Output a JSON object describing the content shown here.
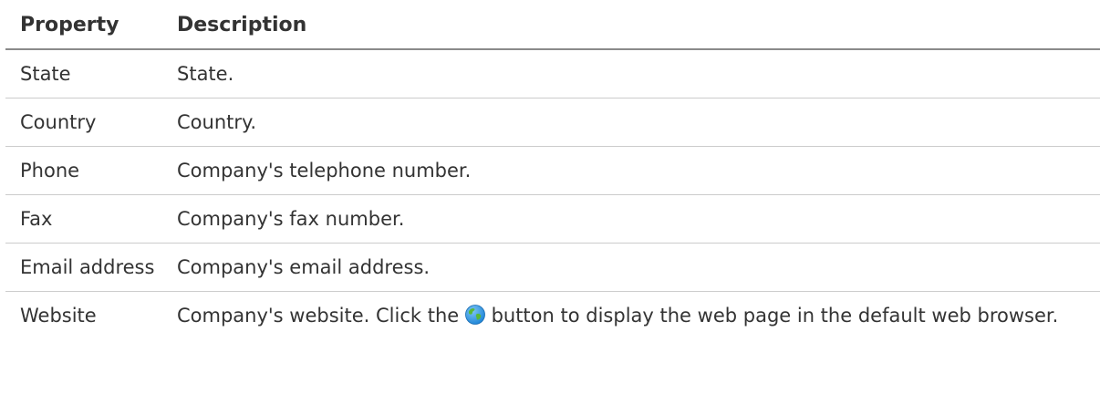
{
  "table": {
    "headers": {
      "property": "Property",
      "description": "Description"
    },
    "rows": [
      {
        "property": "State",
        "description": "State."
      },
      {
        "property": "Country",
        "description": "Country."
      },
      {
        "property": "Phone",
        "description": "Company's telephone number."
      },
      {
        "property": "Fax",
        "description": "Company's fax number."
      },
      {
        "property": "Email address",
        "description": "Company's email address."
      },
      {
        "property": "Website",
        "description_before_icon": "Company's website. Click the",
        "icon": "globe-icon",
        "description_after_icon": "button to display the web page in the default web browser."
      }
    ]
  },
  "colors": {
    "text": "#333333",
    "header_rule": "#8a8a8a",
    "row_rule": "#cccccc",
    "globe_blue": "#1f86d8",
    "globe_green": "#58b838"
  }
}
